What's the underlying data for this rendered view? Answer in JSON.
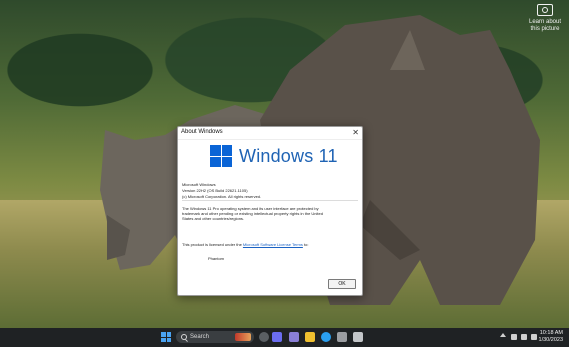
{
  "capture": {
    "label_line1": "Learn about",
    "label_line2": "this picture"
  },
  "dialog": {
    "title": "About Windows",
    "close_glyph": "✕",
    "wordmark": "Windows 11",
    "product": "Microsoft Windows",
    "version": "Version 22H2 (OS Build 22621.1105)",
    "copyright": "(c) Microsoft Corporation. All rights reserved.",
    "description": "The Windows 11 Pro operating system and its user interface are protected by trademark and other pending or existing intellectual property rights in the United States and other countries/regions.",
    "license_prefix": "This product is licensed under the ",
    "license_link": "Microsoft Software License Terms",
    "license_suffix": " to:",
    "licensee": "Phantom",
    "ok_label": "OK"
  },
  "taskbar": {
    "search_placeholder": "Search",
    "time": "10:18 AM",
    "date": "1/30/2023",
    "icons": [
      "start-icon",
      "file-explorer-icon",
      "edge-icon",
      "store-icon",
      "teams-icon",
      "settings-icon"
    ]
  }
}
